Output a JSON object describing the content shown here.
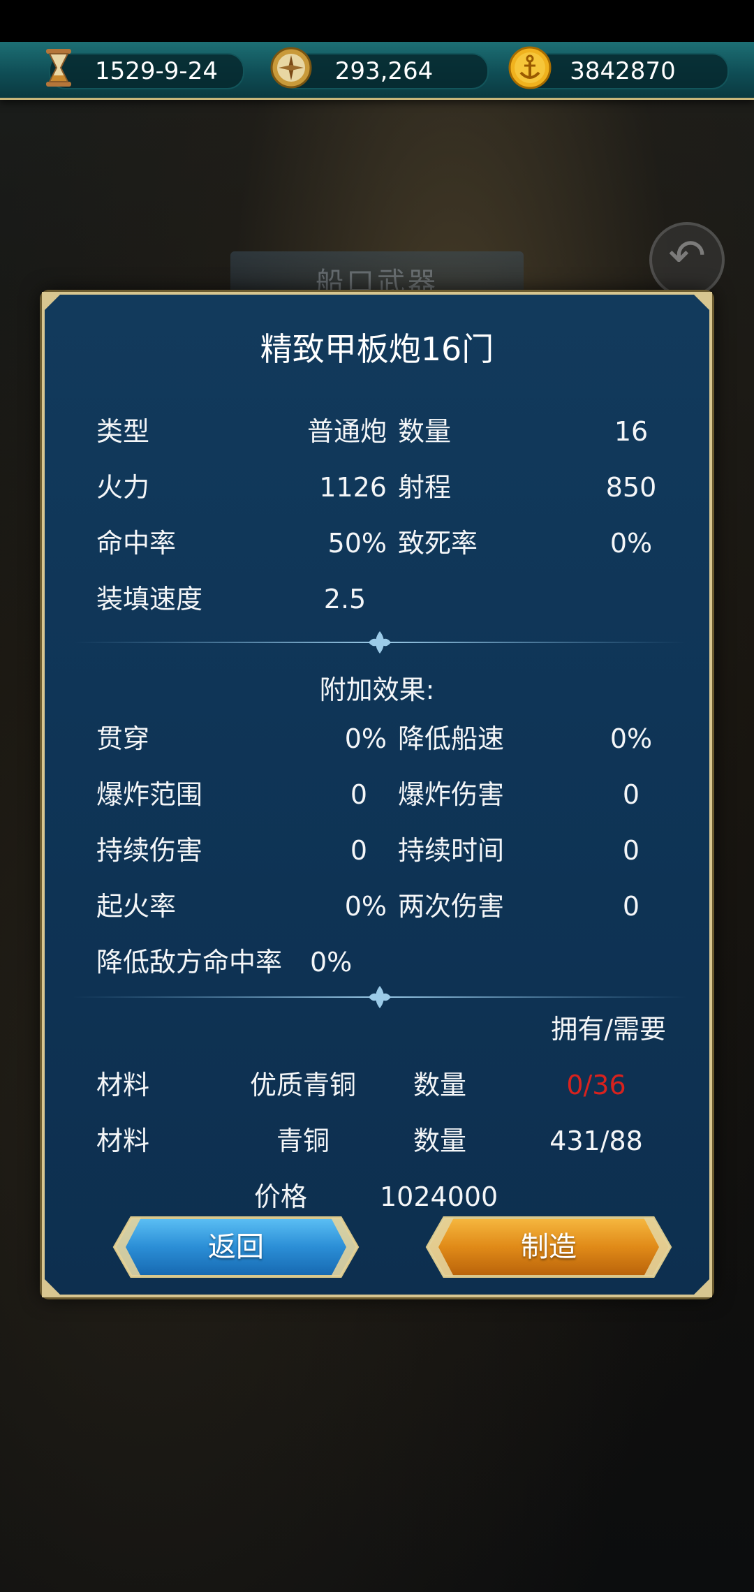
{
  "background": {
    "ghost_title": "船口武器"
  },
  "resources": {
    "date": "1529-9-24",
    "compass_value": "293,264",
    "gold": "3842870",
    "icons": [
      "hourglass-icon",
      "compass-icon",
      "gold-anchor-coin-icon"
    ]
  },
  "dialog": {
    "title": "精致甲板炮16门",
    "stats": [
      {
        "label": "类型",
        "value": "普通炮",
        "label2": "数量",
        "value2": "16"
      },
      {
        "label": "火力",
        "value": "1126",
        "label2": "射程",
        "value2": "850"
      },
      {
        "label": "命中率",
        "value": "50%",
        "label2": "致死率",
        "value2": "0%"
      },
      {
        "label": "装填速度",
        "value": "2.5"
      }
    ],
    "effects_header": "附加效果:",
    "effects": [
      {
        "label": "贯穿",
        "value": "0%",
        "label2": "降低船速",
        "value2": "0%"
      },
      {
        "label": "爆炸范围",
        "value": "0",
        "label2": "爆炸伤害",
        "value2": "0"
      },
      {
        "label": "持续伤害",
        "value": "0",
        "label2": "持续时间",
        "value2": "0"
      },
      {
        "label": "起火率",
        "value": "0%",
        "label2": "两次伤害",
        "value2": "0"
      },
      {
        "label": "降低敌方命中率",
        "value": "0%"
      }
    ],
    "have_need_header": "拥有/需要",
    "materials": [
      {
        "label": "材料",
        "name": "优质青铜",
        "qty_label": "数量",
        "qty": "0/36",
        "qty_color": "#d8221e"
      },
      {
        "label": "材料",
        "name": "青铜",
        "qty_label": "数量",
        "qty": "431/88",
        "qty_color": "#f4f6f8"
      }
    ],
    "price_label": "价格",
    "price": "1024000",
    "buttons": {
      "back": "返回",
      "craft": "制造"
    }
  },
  "colors": {
    "dialog_bg": "#0f3557",
    "border_gold": "#d8c690",
    "back_button": "#2f8fd8",
    "craft_button": "#e08a18",
    "insufficient": "#d8221e"
  }
}
